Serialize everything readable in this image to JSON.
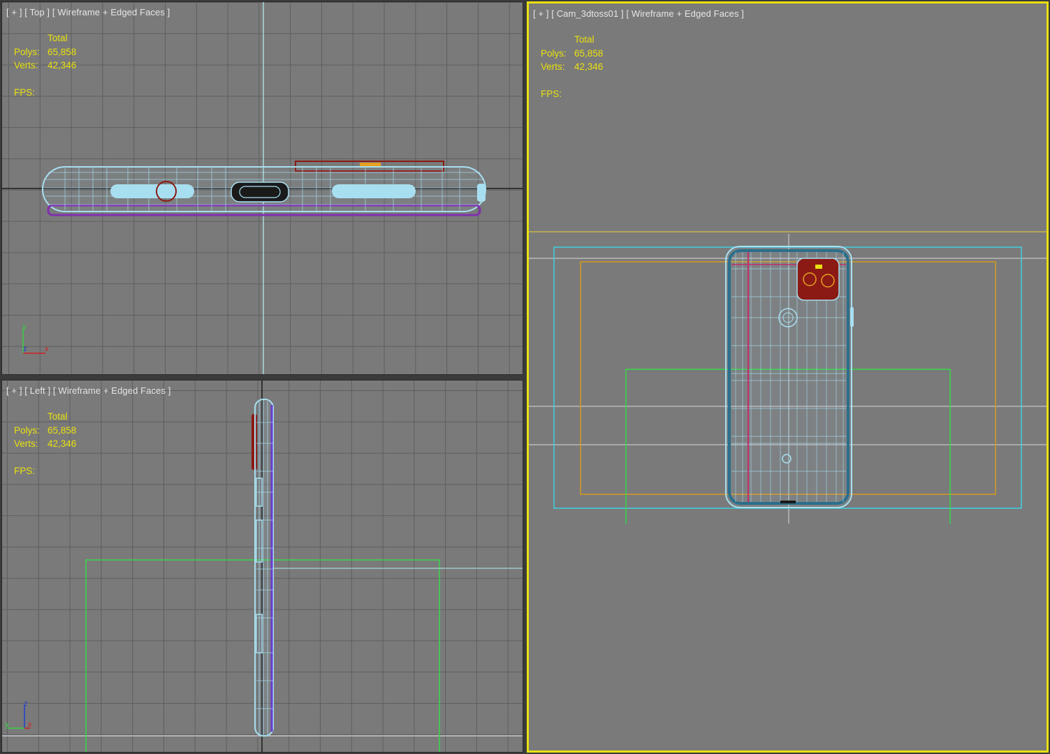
{
  "viewports": {
    "top": {
      "plus": "[ + ]",
      "view": "[ Top ]",
      "shading": "[ Wireframe + Edged Faces ]",
      "axis": {
        "up": "y",
        "right": "x",
        "origin": "z"
      }
    },
    "left": {
      "plus": "[ + ]",
      "view": "[ Left ]",
      "shading": "[ Wireframe + Edged Faces ]",
      "axis": {
        "up": "z",
        "right": "x",
        "origin": "y"
      }
    },
    "camera": {
      "plus": "[ + ]",
      "view": "[ Cam_3dtoss01 ]",
      "shading": "[ Wireframe + Edged Faces ]"
    }
  },
  "stats": {
    "total_label": "Total",
    "polys_label": "Polys:",
    "polys_value": "65,858",
    "verts_label": "Verts:",
    "verts_value": "42,346",
    "fps_label": "FPS:"
  },
  "colors": {
    "viewport_bg": "#7a7a7a",
    "grid_line": "#5e5e5e",
    "active_border": "#e8e010",
    "stats_text": "#e8e010",
    "wire_cyan": "#a8dff0",
    "wire_dark": "#2b6f8c",
    "camera_red": "#8b1a14",
    "safe_frame_green": "#39d84a",
    "safe_frame_orange": "#d89a20",
    "safe_frame_cyan": "#40d0e0"
  }
}
